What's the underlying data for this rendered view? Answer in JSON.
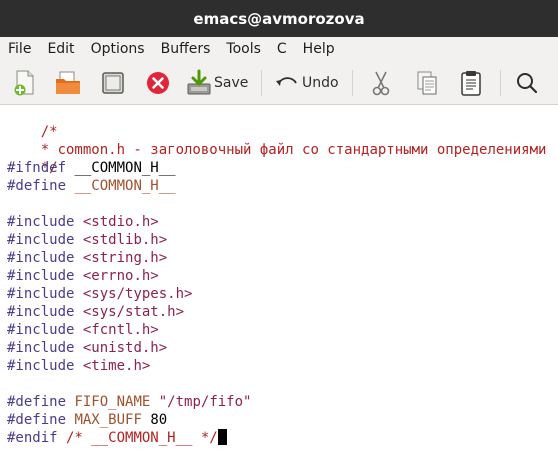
{
  "window": {
    "title": "emacs@avmorozova"
  },
  "menubar": {
    "items": [
      "File",
      "Edit",
      "Options",
      "Buffers",
      "Tools",
      "C",
      "Help"
    ]
  },
  "toolbar": {
    "save_label": "Save",
    "undo_label": "Undo"
  },
  "icons": {
    "new_file": "new-file-icon",
    "open": "open-folder-icon",
    "dired": "dired-icon",
    "close": "close-buffer-icon",
    "save": "save-icon",
    "undo": "undo-arrow-icon",
    "cut": "scissors-icon",
    "copy": "copy-icon",
    "paste": "clipboard-icon",
    "search": "search-icon"
  },
  "colors": {
    "comment": "#b22222",
    "preprocessor": "#483d8b",
    "string": "#8b2252",
    "variable": "#a0522d",
    "close_button": "#e0263a"
  },
  "editor": {
    "comment_open": "/*",
    "comment_body": "* common.h - заголовочный файл со стандартными определениями",
    "comment_close": "*/",
    "ifndef_kw": "#ifndef",
    "ifndef_name": "__COMMON_H__",
    "define_kw1": "#define",
    "define_name1": "__COMMON_H__",
    "include_kw": "#include",
    "includes": [
      "<stdio.h>",
      "<stdlib.h>",
      "<string.h>",
      "<errno.h>",
      "<sys/types.h>",
      "<sys/stat.h>",
      "<fcntl.h>",
      "<unistd.h>",
      "<time.h>"
    ],
    "define_kw2": "#define",
    "fifo_name": "FIFO_NAME",
    "fifo_value": "\"/tmp/fifo\"",
    "define_kw3": "#define",
    "max_buff": "MAX_BUFF",
    "max_buff_value": "80",
    "endif_kw": "#endif",
    "endif_comment": "/* __COMMON_H__ */"
  }
}
